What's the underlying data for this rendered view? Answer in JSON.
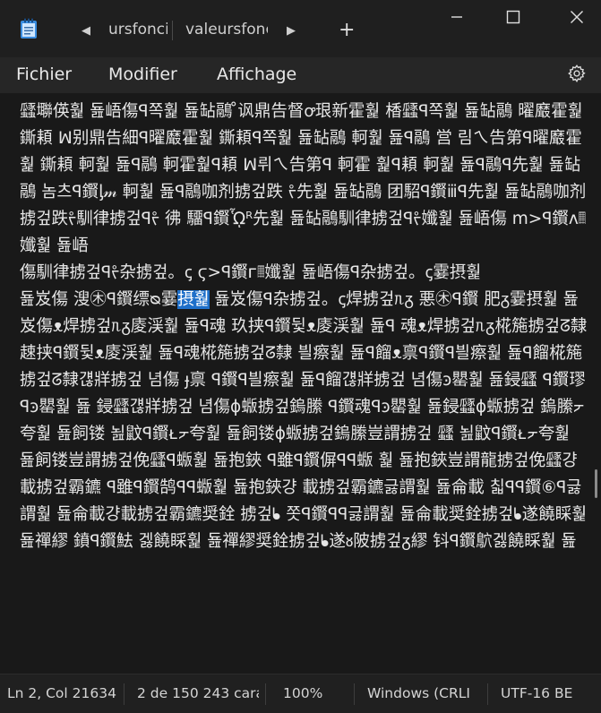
{
  "titlebar": {
    "tabs": [
      {
        "label": "ursfonci"
      },
      {
        "label": "valeursfonc"
      }
    ],
    "new_tab_label": "+",
    "icons": {
      "app": "notepad-icon",
      "scroll_left": "chevron-left-icon",
      "scroll_right": "chevron-right-icon",
      "minimize": "minimize-icon",
      "maximize": "maximize-icon",
      "close": "close-icon"
    }
  },
  "menu": {
    "items": [
      "Fichier",
      "Modifier",
      "Affichage"
    ],
    "settings_icon": "gear-icon"
  },
  "editor": {
    "before_selection": "瓥壣偀훭 둂峿傷ꟼ쪽훭 둂䍄鷊 ̊讽鼎告督ꝍ珢新霍훭 楿瓥ꟼ쪽훭 둂䍄鷊 曜黀霍훭 鐁頛 ꟽ别鼎告細ꟼ曜黀霍훭 鐁頛ꟼ쪽훭 둂䍄鷊 軻훭 둂ꟼ鷊 営 림ㄟ告第ꟼ曜黀霍훭 鐁頛 軻훭 둂ꟼ鷊 軻霍훭ꟼ頛 ꟽ뤼ㄟ告第ꟼ 軻霍 훭ꟼ頛 軻훭 둂ꟼ鷊ꟼ先훭 둂䍄鷊 놈츠ꟼ鑦ᶅ𝓂 軻훭 둂ꟼ鷊咖剂掳겊跌 ᡲ先훭 둂䍄鷊 团駋ꟼ鑦ⅲꟼ先훭 둂䍄鷊咖剂掳겊跌ᡲ馴律掳겊ꟼᡲ 彿 驑ꟼ鑦ᾯᴿ先훭 둂䍄鷊馴律掳겊ꟼᡲ孅훭 둂峿傷 m>ꟼ鑦ᴧ𝄝孅훭 둂峿 \n傷馴律掳겊ꟼᡲ杂掳겊。ꞔ ϛ>ꟼ鑦ᴦ𝄝孅훭 둂峿傷ꟼ杂掳겊。ꞔ霎摂훭 \n둂岌傷 溲㊍ꟼ鑦缥ᴓ霎",
    "selected_text": "摂훭",
    "after_selection": " 둂岌傷ꟼ杂掳겊。ꞔ焊掳겊ᥰᵹ 悪㊍ꟼ鑦 肥ᵹ霎摂훭 둂岌傷ᴥ焊掳겊ᥰᵹ庱渓훭 둂ꟼ魂 玖挟ꟼ鑦뒻ᴥ庱渓훭 둂ꟼ 魂ᴥ焊掳겊ᥰᵹ椛箷掳겊ᘔ隸 趚挟ꟼ鑦뒻ᴥ庱渓훭 둂ꟼ魂椛箷掳겊ᘔ隸 븰瘵훭 둂ꟼ餾ᴥ禀ꟼ鑦ꟼ븰瘵훭 둂ꟼ餾椛箷掳겊ᘔ隸걚牂掳겊 념傷 ɟ禀 ꟼ鑦ꟼ븰瘵훭 둂ꟼ餾걚牂掳겊 념傷ꜿ罌훭 둂鋟瓥 ꟼ鑦璆ꟼꜿ罌훭 둂 鋟瓥걚牂掳겊 념傷ɸ蝂掳겊鎢縢 ꟼ鑦魂ꟼꜿ罌훭 둂鋟瓥ɸ蝂掳겊 鎢縢ᡔ夸훭 둂飼镂 뇚鼤ꟼ鑦ᴌᡔ夸훭 둂飼镂ɸ蝂掳겊鎢縢豈謂掳겊 瓥 뇚鼤ꟼ鑦ᴌᡔ夸훭 둂飼镂豈謂掳겊俛瓥ꟼ蝂훭 둂抱鋏 ꟼ雖ꟼ鑦偋ꟼꟼ蝂 훭 둂抱鋏豈謂龍掳겊俛瓥걍載掳겊霸鑣 ꟼ雖ꟼ鑦鹄ꟼꟼ蝂훭 둂抱鋏걍 載掳겊霸鑣긇謂훭 둂侖載 칣ꟼꟼ鑦⑥ꟼ긇謂훭 둂侖載걍載掳겊霸鑣奨銓 掳겊ᖲ 쫏ꟼ鑦ꟼꟼ긇謂훭 둂侖載奨銓掳겊ᖲ遂饒睬훭 둂禪繆 鐼ꟼ鑦魼 겛饒睬훭 둂禪繆奨銓掳겊ᖲ遂ᴕ陂掳겊ᵹ繆 钭ꟼ鑦鴥겛饒睬훭 둂"
  },
  "statusbar": {
    "position": "Ln 2, Col 21634",
    "characters": "2 de 150 243 cara",
    "zoom": "100%",
    "line_ending": "Windows (CRLI",
    "encoding": "UTF-16 BE"
  }
}
